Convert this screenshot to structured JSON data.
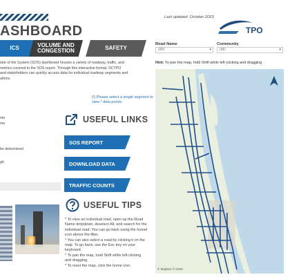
{
  "header": {
    "title": "ASHBOARD",
    "last_updated": "Last updated: October 2023"
  },
  "tabs": [
    {
      "label": "ICS"
    },
    {
      "label": "VOLUME AND CONGESTION"
    },
    {
      "label": "SAFETY"
    }
  ],
  "description_lines": [
    "tate of the System (SOS) dashboard houses a variety of roadway, traffic, and",
    "metrics covered in the SOS report. Through this interactive format, SCTPO",
    "and stakeholders can quickly access data for individual roadway segments and",
    "ations."
  ],
  "segment_hint": "(!) Please select a single segment to view * data points.",
  "left_fragments": [
    "me",
    "me",
    "be determined",
    "gh"
  ],
  "useful_links": {
    "title": "USEFUL LINKS",
    "buttons": [
      "SOS REPORT",
      "DOWNLOAD DATA",
      "TRAFFIC COUNTS"
    ]
  },
  "useful_tips": {
    "title": "USEFUL TIPS",
    "items": [
      "* To view an individual road, open up the Road Name dropdown, deselect All, and search for the individual road. You can go back using the funnel icon above the filter.",
      "* You can also select a road by clicking it on the map. To go back, use the Esc key on your keyboard.",
      "* To pan the map, hold Shift while left-clicking and dragging.",
      "* To reset the map, click the home icon."
    ]
  },
  "logo": {
    "text": "TPO"
  },
  "filters": {
    "road_name": {
      "label": "Road Name",
      "value": "(All)"
    },
    "community": {
      "label": "Community",
      "value": "(All)"
    }
  },
  "map": {
    "hint_prefix": "Hint:",
    "hint": "To pan the map, hold Shift while left-clicking and dragging",
    "attribution": "© Mapbox  © OSM",
    "colors": {
      "land": "#eaf0df",
      "water": "#bfd9ea",
      "road": "#1f4e8c",
      "urban": "#d9d6cc"
    }
  },
  "colors": {
    "accent": "#1f6fb5",
    "navy": "#1f4e79",
    "tab_dark": "#3d3d3d"
  }
}
